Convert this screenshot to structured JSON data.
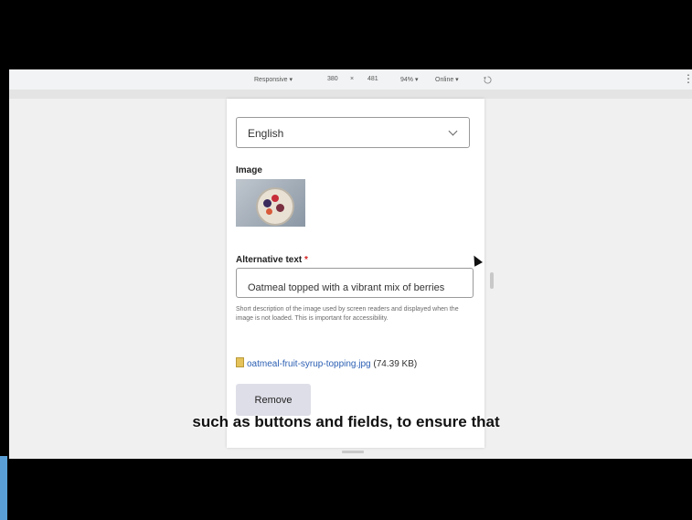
{
  "toolbar": {
    "device": "Responsive ▾",
    "width": "380",
    "times": "×",
    "height": "481",
    "zoom": "94% ▾",
    "network": "Online ▾",
    "menu": "⋮"
  },
  "form": {
    "language_value": "English",
    "image_label": "Image",
    "alt_label": "Alternative text",
    "required_mark": "*",
    "alt_value": "Oatmeal topped with a vibrant mix of berries",
    "help_text": "Short description of the image used by screen readers and displayed when the image is not loaded. This is important for accessibility.",
    "file_name": "oatmeal-fruit-syrup-topping.jpg",
    "file_size": "(74.39 KB)",
    "remove_label": "Remove"
  },
  "caption": "such as buttons and fields, to ensure that",
  "colors": {
    "link": "#2b5fb3",
    "required": "#d72222",
    "button_bg": "#dedee8",
    "accent": "#5aa0d6"
  }
}
